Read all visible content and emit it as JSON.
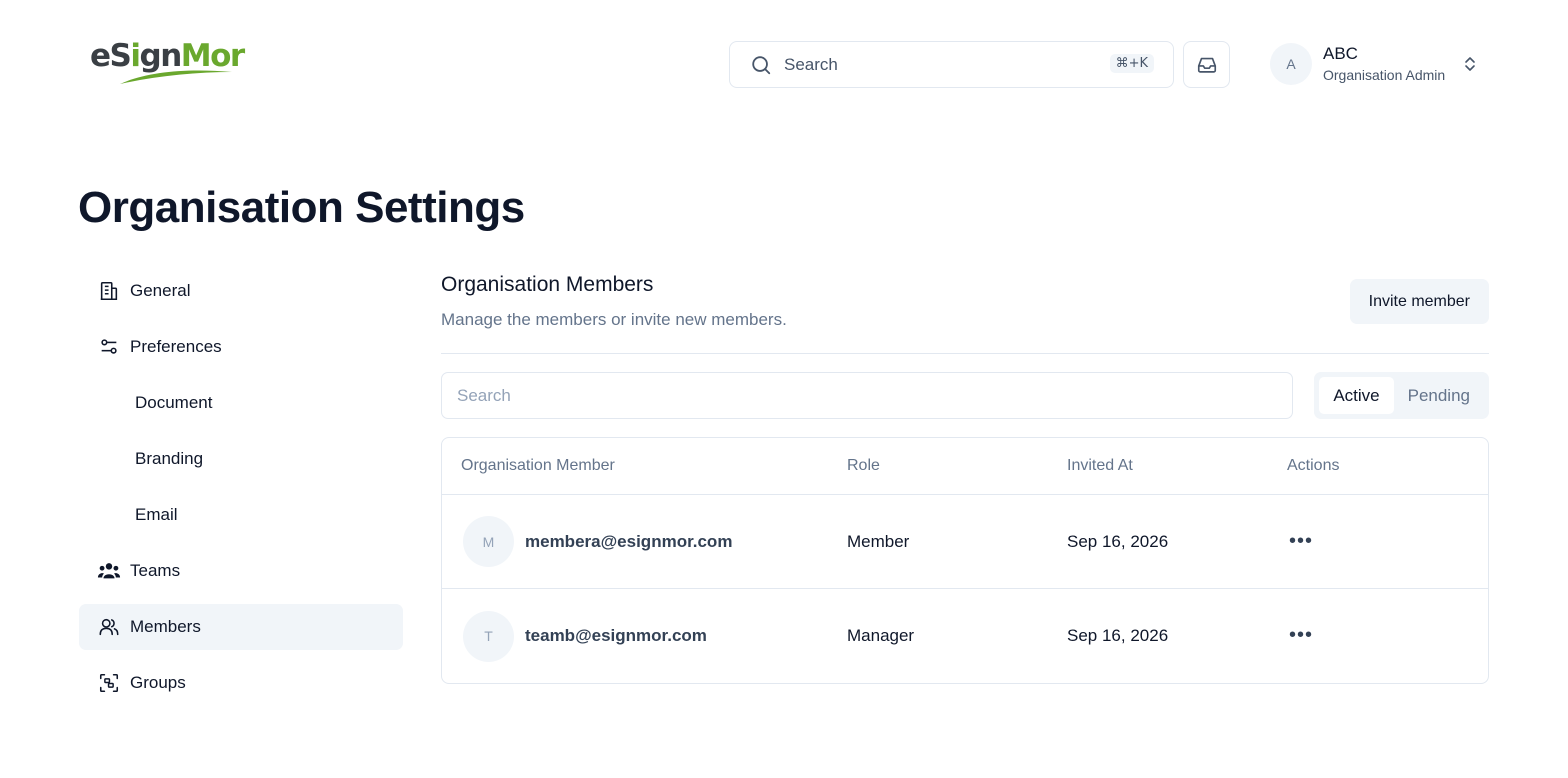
{
  "header": {
    "logo": {
      "part1": "eS",
      "part2": "i",
      "part3": "gn",
      "part4": "Mor"
    },
    "search_label": "Search",
    "search_shortcut": "⌘+K",
    "user": {
      "initial": "A",
      "name": "ABC",
      "role": "Organisation Admin"
    }
  },
  "page_title": "Organisation Settings",
  "sidebar": {
    "items": [
      {
        "label": "General",
        "icon": "building-icon"
      },
      {
        "label": "Preferences",
        "icon": "settings-sliders-icon"
      },
      {
        "label": "Document"
      },
      {
        "label": "Branding"
      },
      {
        "label": "Email"
      },
      {
        "label": "Teams",
        "icon": "users-group-icon"
      },
      {
        "label": "Members",
        "icon": "users-icon",
        "active": true
      },
      {
        "label": "Groups",
        "icon": "group-scan-icon"
      }
    ]
  },
  "main": {
    "title": "Organisation Members",
    "subtitle": "Manage the members or invite new members.",
    "invite_label": "Invite member",
    "filter_placeholder": "Search",
    "tabs": [
      {
        "label": "Active",
        "selected": true
      },
      {
        "label": "Pending",
        "selected": false
      }
    ],
    "table": {
      "headers": [
        "Organisation Member",
        "Role",
        "Invited At",
        "Actions"
      ],
      "rows": [
        {
          "initial": "M",
          "email": "membera@esignmor.com",
          "role": "Member",
          "invited": "Sep 16, 2026",
          "actions": "•••"
        },
        {
          "initial": "T",
          "email": "teamb@esignmor.com",
          "role": "Manager",
          "invited": "Sep 16, 2026",
          "actions": "•••"
        }
      ]
    }
  },
  "colors": {
    "brand_green": "#6aa82e",
    "brand_dark": "#3a3f44",
    "muted": "#64748b",
    "border": "#e2e8f0",
    "subtle_bg": "#f1f5f9"
  }
}
